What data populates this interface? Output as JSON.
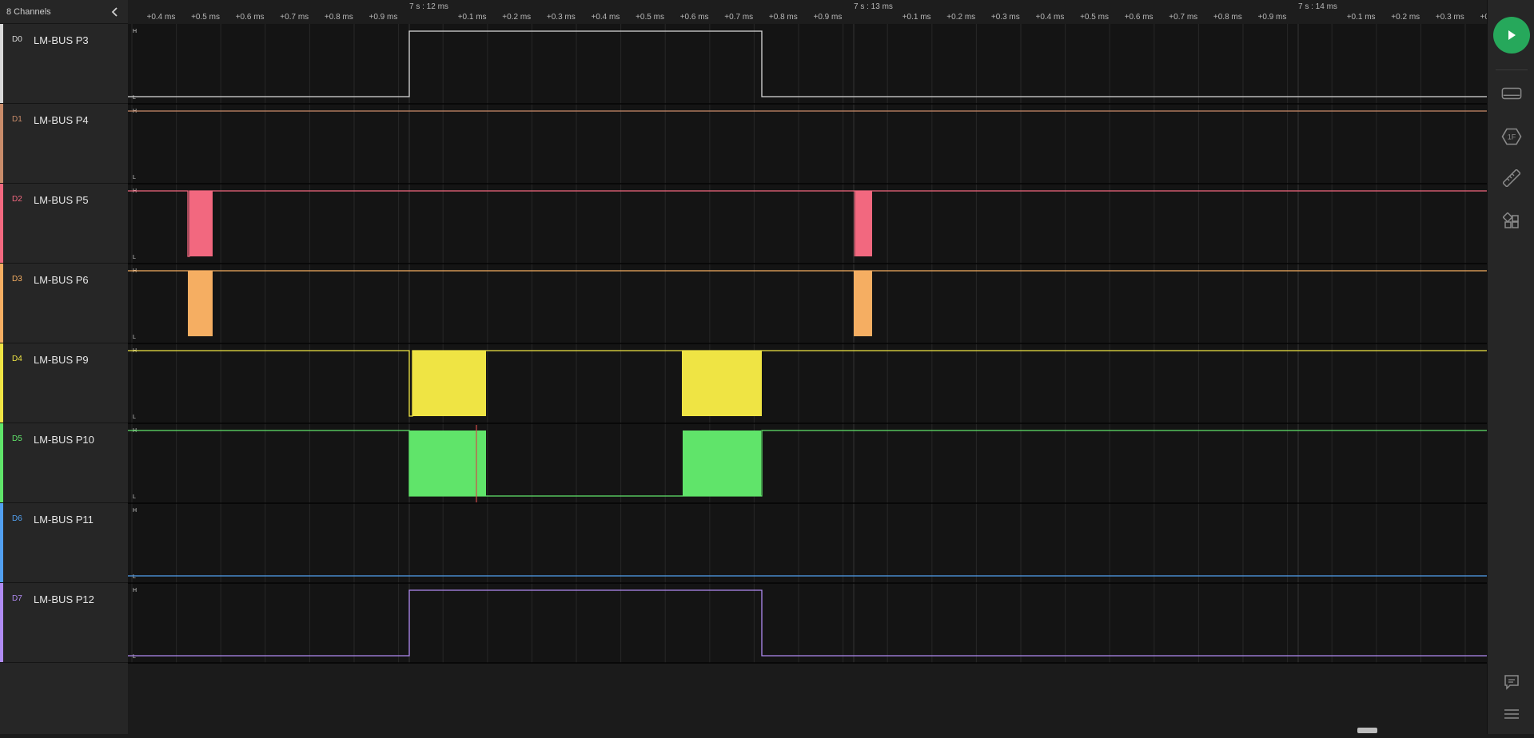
{
  "sidebar": {
    "channels_label": "8 Channels",
    "channels": [
      {
        "id": "D0",
        "name": "LM-BUS P3",
        "color": "#d9d9d9"
      },
      {
        "id": "D1",
        "name": "LM-BUS P4",
        "color": "#c98c6a"
      },
      {
        "id": "D2",
        "name": "LM-BUS P5",
        "color": "#f2687f"
      },
      {
        "id": "D3",
        "name": "LM-BUS P6",
        "color": "#f5ae62"
      },
      {
        "id": "D4",
        "name": "LM-BUS P9",
        "color": "#efe444"
      },
      {
        "id": "D5",
        "name": "LM-BUS P10",
        "color": "#60e46a"
      },
      {
        "id": "D6",
        "name": "LM-BUS P11",
        "color": "#52a0f0"
      },
      {
        "id": "D7",
        "name": "LM-BUS P12",
        "color": "#b08bf2"
      }
    ]
  },
  "ruler": {
    "major_labels": [
      "7 s : 12 ms",
      "7 s : 13 ms",
      "7 s : 14 ms"
    ],
    "minor_labels": [
      "+0.4 ms",
      "+0.5 ms",
      "+0.6 ms",
      "+0.7 ms",
      "+0.8 ms",
      "+0.9 ms",
      "+0.1 ms",
      "+0.2 ms",
      "+0.3 ms",
      "+0.4 ms",
      "+0.5 ms",
      "+0.6 ms",
      "+0.7 ms",
      "+0.8 ms",
      "+0.9 ms",
      "+0.1 ms",
      "+0.2 ms",
      "+0.3 ms",
      "+0.4 ms",
      "+0.5 ms",
      "+0.6 ms",
      "+0.7 ms",
      "+0.8 ms",
      "+0.9 ms",
      "+0.1 ms",
      "+0.2 ms",
      "+0.3 ms",
      "+0"
    ]
  },
  "level_labels": {
    "high": "H",
    "low": "L"
  },
  "right_toolbar": {
    "buttons": [
      "play-icon",
      "device-icon",
      "analyzer-hex-icon",
      "measure-ruler-icon",
      "extensions-icon",
      "chat-icon",
      "menu-icon"
    ],
    "analyzer_badge": "1F"
  }
}
